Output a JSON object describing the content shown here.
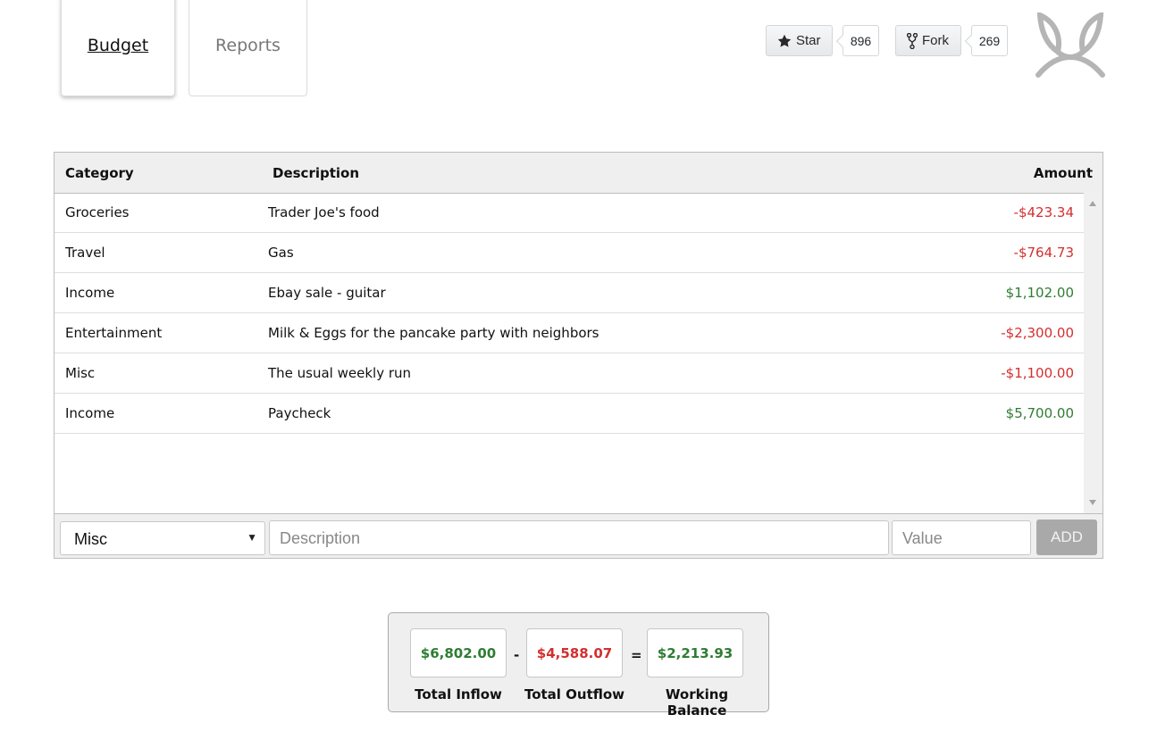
{
  "tabs": [
    {
      "label": "Budget",
      "active": true
    },
    {
      "label": "Reports",
      "active": false
    }
  ],
  "github": {
    "star_label": "Star",
    "star_count": "896",
    "fork_label": "Fork",
    "fork_count": "269"
  },
  "table": {
    "headers": {
      "category": "Category",
      "description": "Description",
      "amount": "Amount"
    },
    "rows": [
      {
        "category": "Groceries",
        "description": "Trader Joe's food",
        "amount": "-$423.34",
        "sign": "negative"
      },
      {
        "category": "Travel",
        "description": "Gas",
        "amount": "-$764.73",
        "sign": "negative"
      },
      {
        "category": "Income",
        "description": "Ebay sale - guitar",
        "amount": "$1,102.00",
        "sign": "positive"
      },
      {
        "category": "Entertainment",
        "description": "Milk & Eggs for the pancake party with neighbors",
        "amount": "-$2,300.00",
        "sign": "negative"
      },
      {
        "category": "Misc",
        "description": "The usual weekly run",
        "amount": "-$1,100.00",
        "sign": "negative"
      },
      {
        "category": "Income",
        "description": "Paycheck",
        "amount": "$5,700.00",
        "sign": "positive"
      }
    ]
  },
  "entry_form": {
    "category_selected": "Misc",
    "description_placeholder": "Description",
    "value_placeholder": "Value",
    "add_label": "ADD"
  },
  "summary": {
    "inflow_value": "$6,802.00",
    "outflow_value": "$4,588.07",
    "balance_value": "$2,213.93",
    "minus_symbol": "-",
    "equals_symbol": "=",
    "inflow_label": "Total Inflow",
    "outflow_label": "Total Outflow",
    "balance_label": "Working Balance"
  },
  "colors": {
    "negative": "#d32f2f",
    "positive": "#2e7d32",
    "header_bg": "#efefef",
    "logo": "#b5b5b5"
  },
  "icons": {
    "star": "star-icon",
    "fork": "fork-icon",
    "logo": "leaf-logo-icon",
    "select_caret": "caret-down-icon"
  }
}
